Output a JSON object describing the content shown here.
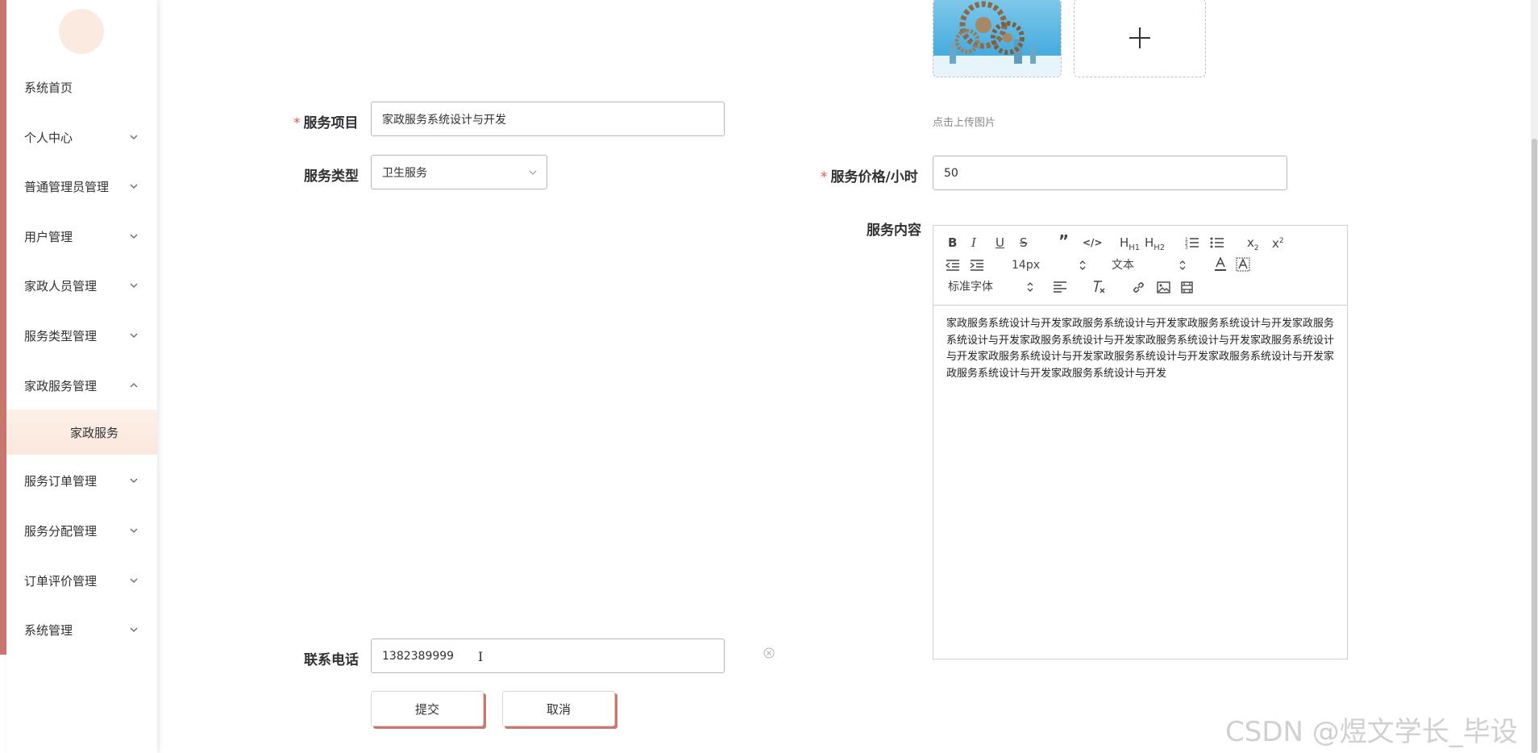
{
  "sidebar": {
    "items": [
      {
        "label": "系统首页",
        "has_arrow": false
      },
      {
        "label": "个人中心",
        "has_arrow": true,
        "arrow": "down"
      },
      {
        "label": "普通管理员管理",
        "has_arrow": true,
        "arrow": "down"
      },
      {
        "label": "用户管理",
        "has_arrow": true,
        "arrow": "down"
      },
      {
        "label": "家政人员管理",
        "has_arrow": true,
        "arrow": "down"
      },
      {
        "label": "服务类型管理",
        "has_arrow": true,
        "arrow": "down"
      },
      {
        "label": "家政服务管理",
        "has_arrow": true,
        "arrow": "up"
      },
      {
        "label": "服务订单管理",
        "has_arrow": true,
        "arrow": "down"
      },
      {
        "label": "服务分配管理",
        "has_arrow": true,
        "arrow": "down"
      },
      {
        "label": "订单评价管理",
        "has_arrow": true,
        "arrow": "down"
      },
      {
        "label": "系统管理",
        "has_arrow": true,
        "arrow": "down"
      }
    ],
    "active_sub": "家政服务"
  },
  "form": {
    "service_item": {
      "label": "服务项目",
      "value": "家政服务系统设计与开发",
      "required": true
    },
    "service_type": {
      "label": "服务类型",
      "value": "卫生服务"
    },
    "price": {
      "label": "服务价格/小时",
      "value": "50",
      "required": true
    },
    "content": {
      "label": "服务内容"
    },
    "phone": {
      "label": "联系电话",
      "value": "1382389999"
    },
    "upload_hint": "点击上传图片"
  },
  "editor": {
    "font_size": "14px",
    "header_select": "文本",
    "font_select": "标准字体",
    "text": "家政服务系统设计与开发家政服务系统设计与开发家政服务系统设计与开发家政服务系统设计与开发家政服务系统设计与开发家政服务系统设计与开发家政服务系统设计与开发家政服务系统设计与开发家政服务系统设计与开发家政服务系统设计与开发家政服务系统设计与开发家政服务系统设计与开发",
    "h1": "H1",
    "h2": "H2"
  },
  "buttons": {
    "submit": "提交",
    "cancel": "取消"
  },
  "watermark": "CSDN @煜文学长_毕设",
  "colors": {
    "accent": "#c9776e",
    "active_bg": "#fbe7dc",
    "required": "#e05555"
  }
}
